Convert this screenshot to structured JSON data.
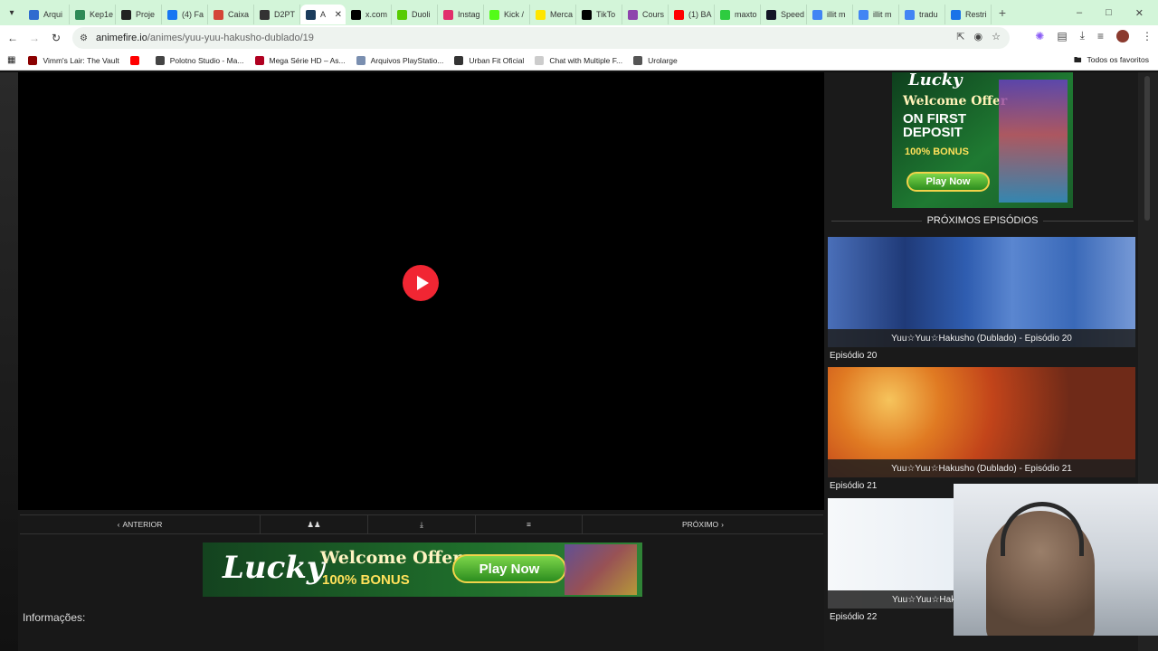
{
  "browser": {
    "tabs": [
      {
        "title": "Arqui",
        "color": "#2f6ccf",
        "active": false
      },
      {
        "title": "Kep1e",
        "color": "#2e8b57",
        "active": false
      },
      {
        "title": "Proje",
        "color": "#222222",
        "active": false
      },
      {
        "title": "(4) Fa",
        "color": "#1877f2",
        "active": false
      },
      {
        "title": "Caixa",
        "color": "#d44638",
        "active": false
      },
      {
        "title": "D2PT",
        "color": "#333333",
        "active": false
      },
      {
        "title": "A",
        "color": "#1a3b5c",
        "active": true
      },
      {
        "title": "x.com",
        "color": "#000000",
        "active": false
      },
      {
        "title": "Duoli",
        "color": "#58cc02",
        "active": false
      },
      {
        "title": "Instag",
        "color": "#e1306c",
        "active": false
      },
      {
        "title": "Kick /",
        "color": "#53fc18",
        "active": false
      },
      {
        "title": "Merca",
        "color": "#ffe600",
        "active": false
      },
      {
        "title": "TikTo",
        "color": "#010101",
        "active": false
      },
      {
        "title": "Cours",
        "color": "#8e44ad",
        "active": false
      },
      {
        "title": "(1) BA",
        "color": "#ff0000",
        "active": false
      },
      {
        "title": "maxto",
        "color": "#2ecc40",
        "active": false
      },
      {
        "title": "Speed",
        "color": "#141526",
        "active": false
      },
      {
        "title": "illit m",
        "color": "#4285f4",
        "active": false
      },
      {
        "title": "illit m",
        "color": "#4285f4",
        "active": false
      },
      {
        "title": "tradu",
        "color": "#4285f4",
        "active": false
      },
      {
        "title": "Restri",
        "color": "#1a73e8",
        "active": false
      }
    ],
    "url_domain": "animefire.io",
    "url_path": "/animes/yuu-yuu-hakusho-dublado/19",
    "bookmarks": [
      {
        "label": "Vimm's Lair: The Vault",
        "color": "#8b0000"
      },
      {
        "label": "",
        "color": "#ff0000"
      },
      {
        "label": "Polotno Studio - Ma...",
        "color": "#444444"
      },
      {
        "label": "Mega Série HD – As...",
        "color": "#b00020"
      },
      {
        "label": "Arquivos PlayStatio...",
        "color": "#7a8fb0"
      },
      {
        "label": "Urban Fit Oficial",
        "color": "#333333"
      },
      {
        "label": "Chat with Multiple F...",
        "color": "#cccccc"
      },
      {
        "label": "Urolarge",
        "color": "#555555"
      }
    ],
    "all_bookmarks": "Todos os favoritos"
  },
  "player": {
    "nav": {
      "previous": "ANTERIOR",
      "next": "PRÓXIMO"
    }
  },
  "ad_banner": {
    "brand": "Lucky",
    "offer": "Welcome Offer",
    "bonus": "100% BONUS",
    "cta": "Play Now"
  },
  "side_ad": {
    "brand": "Lucky",
    "welcome": "Welcome Offer",
    "deposit": "ON FIRST DEPOSIT",
    "bonus": "100% BONUS",
    "cta": "Play Now"
  },
  "section": {
    "info_title": "Informações:",
    "next_episodes_title": "PRÓXIMOS EPISÓDIOS"
  },
  "episodes": [
    {
      "caption": "Yuu☆Yuu☆Hakusho (Dublado) - Episódio 20",
      "label": "Episódio 20"
    },
    {
      "caption": "Yuu☆Yuu☆Hakusho (Dublado) - Episódio 21",
      "label": "Episódio 21"
    },
    {
      "caption": "Yuu☆Yuu☆Hak",
      "label": "Episódio 22"
    }
  ]
}
